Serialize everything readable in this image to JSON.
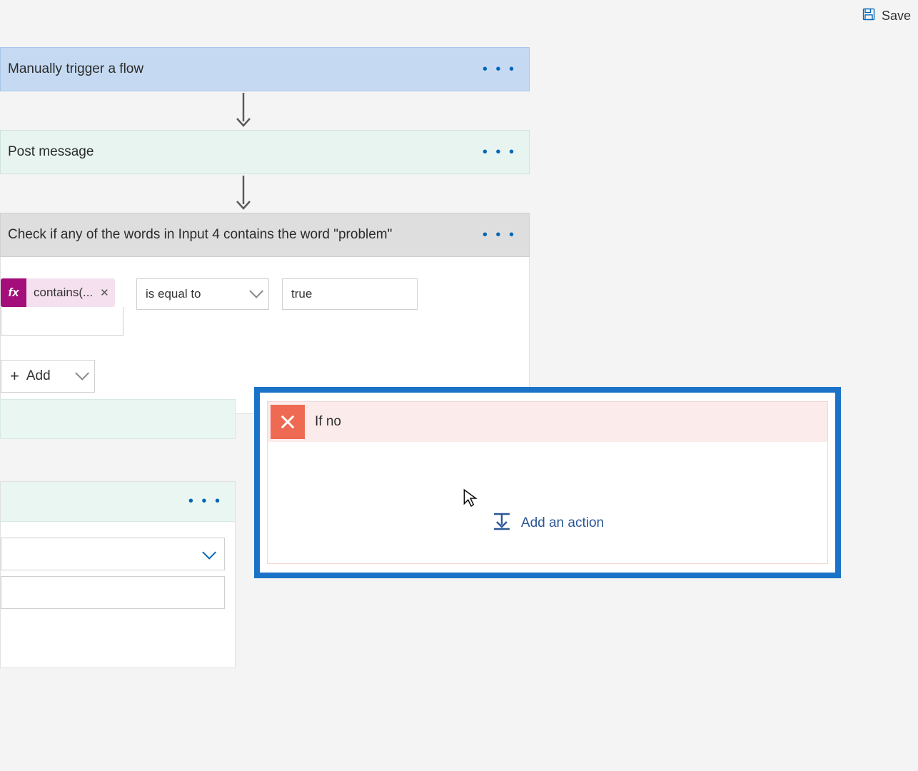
{
  "toolbar": {
    "save_label": "Save"
  },
  "steps": {
    "trigger": {
      "title": "Manually trigger a flow"
    },
    "post": {
      "title": "Post message"
    },
    "condition_header": {
      "title": "Check if any of the words in Input 4 contains the word \"problem\""
    }
  },
  "condition": {
    "expression_label": "contains(...",
    "operator": "is equal to",
    "value": "true",
    "add_label": "Add"
  },
  "branches": {
    "no": {
      "title": "If no",
      "add_action_label": "Add an action"
    }
  },
  "icons": {
    "fx": "fx",
    "ellipsis": "• • •",
    "plus": "+"
  }
}
